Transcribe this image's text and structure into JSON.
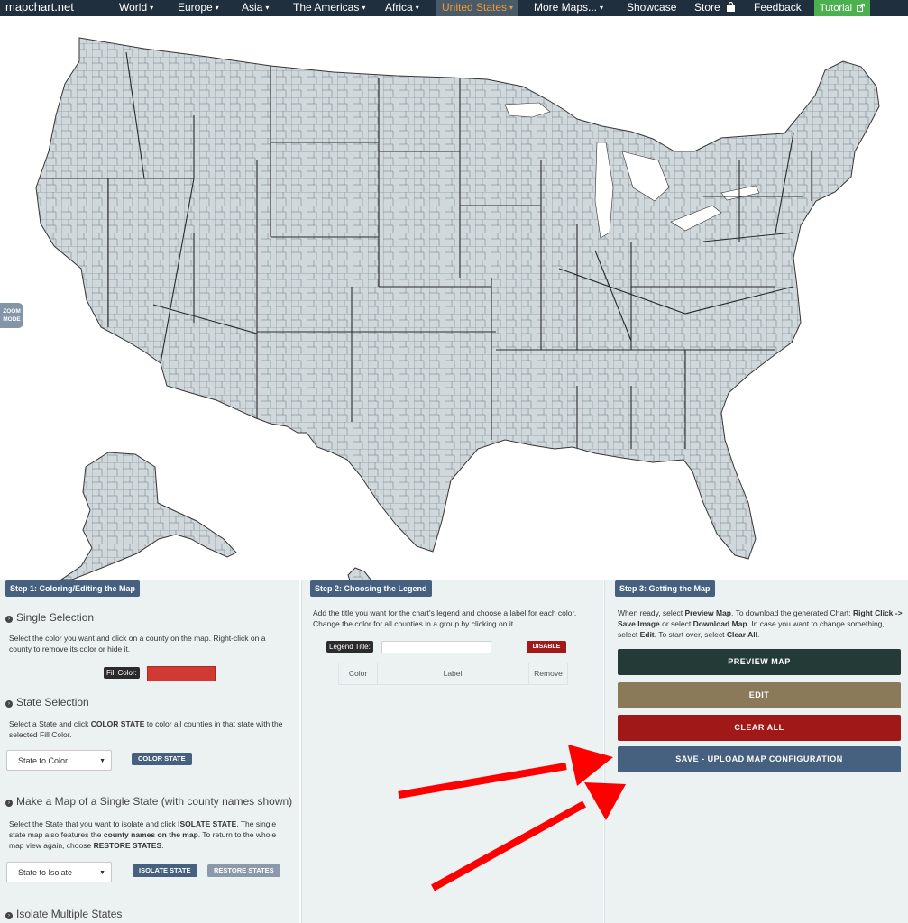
{
  "brand": "mapchart.net",
  "nav": {
    "items": [
      {
        "label": "World",
        "caret": "▾"
      },
      {
        "label": "Europe",
        "caret": "▾"
      },
      {
        "label": "Asia",
        "caret": "▾"
      },
      {
        "label": "The Americas",
        "caret": "▾"
      },
      {
        "label": "Africa",
        "caret": "▾"
      },
      {
        "label": "United States",
        "caret": "▾",
        "active": true
      },
      {
        "label": "More Maps...",
        "caret": "▾"
      },
      {
        "label": "Showcase"
      },
      {
        "label": "Store",
        "icon": "shopping-bag-icon"
      },
      {
        "label": "Feedback"
      }
    ],
    "tutorial": "Tutorial",
    "tutorial_icon": "external-link-icon",
    "dropdown_icon": "chevron-down-icon"
  },
  "map": {
    "zoom_line1": "ZOOM",
    "zoom_line2": "MODE",
    "fill_color": "#d0d8dc",
    "border_color": "#333333"
  },
  "step1": {
    "title": "Step 1: Coloring/Editing the Map",
    "single": {
      "heading": "Single Selection",
      "desc": "Select the color you want and click on a county on the map. Right-click on a county to remove its color or hide it.",
      "fill_label": "Fill Color:",
      "fill_value": "#d13a32"
    },
    "state": {
      "heading": "State Selection",
      "desc_a": "Select a State and click ",
      "desc_b": "COLOR STATE",
      "desc_c": " to color all counties in that state with the selected Fill Color.",
      "select_value": "State to Color",
      "button": "COLOR STATE"
    },
    "single_state": {
      "heading": "Make a Map of a Single State (with county names shown)",
      "desc_a": "Select the State that you want to isolate and click ",
      "desc_b": "ISOLATE STATE",
      "desc_c": ". The single state map also features the ",
      "desc_d": "county names on the map",
      "desc_e": ". To return to the whole map view again, choose ",
      "desc_f": "RESTORE STATES",
      "desc_g": ".",
      "select_value": "State to Isolate",
      "isolate_button": "ISOLATE STATE",
      "restore_button": "RESTORE STATES"
    },
    "multi": {
      "heading": "Isolate Multiple States"
    }
  },
  "step2": {
    "title": "Step 2: Choosing the Legend",
    "desc": "Add the title you want for the chart's legend and choose a label for each color. Change the color for all counties in a group by clicking on it.",
    "legend_title_label": "Legend Title:",
    "legend_title_value": "",
    "disable_button": "DISABLE",
    "columns": [
      "Color",
      "Label",
      "Remove"
    ]
  },
  "step3": {
    "title": "Step 3: Getting the Map",
    "desc_a": "When ready, select ",
    "desc_b": "Preview Map",
    "desc_c": ". To download the generated Chart: ",
    "desc_d": "Right Click -> Save Image",
    "desc_e": " or select ",
    "desc_f": "Download Map",
    "desc_g": ". In case you want to change something, select ",
    "desc_h": "Edit",
    "desc_i": ". To start over, select ",
    "desc_j": "Clear All",
    "desc_k": ".",
    "buttons": {
      "preview": "PREVIEW MAP",
      "edit": "EDIT",
      "clear": "CLEAR ALL",
      "save": "SAVE - UPLOAD MAP CONFIGURATION"
    },
    "colors": {
      "preview": "#233a36",
      "edit": "#8b7a5a",
      "clear": "#a01818",
      "save": "#46607f"
    }
  },
  "annotation": {
    "arrow_color": "#ff0000"
  }
}
